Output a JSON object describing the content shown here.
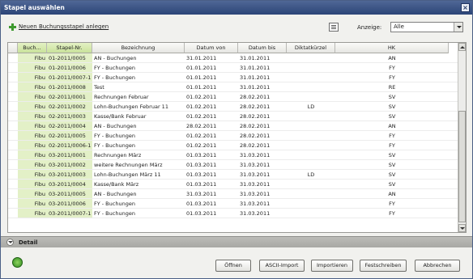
{
  "window": {
    "title": "Stapel auswählen",
    "close_glyph": "×"
  },
  "toolbar": {
    "new_label": "Neuen Buchungsstapel anlegen",
    "anzeige_label": "Anzeige:",
    "anzeige_value": "Alle"
  },
  "table": {
    "columns": [
      "",
      "Buch...",
      "Stapel-Nr.",
      "Bezeichnung",
      "Datum von",
      "Datum bis",
      "Diktatkürzel",
      "HK"
    ],
    "rows": [
      [
        "Fibu",
        "01-2011/0005",
        "AN - Buchungen",
        "31.01.2011",
        "31.01.2011",
        "",
        "AN"
      ],
      [
        "Fibu",
        "01-2011/0006",
        "FY - Buchungen",
        "01.01.2011",
        "31.01.2011",
        "",
        "FY"
      ],
      [
        "Fibu",
        "01-2011/0007-1",
        "FY - Buchungen",
        "01.01.2011",
        "31.01.2011",
        "",
        "FY"
      ],
      [
        "Fibu",
        "01-2011/0008",
        "Test",
        "01.01.2011",
        "31.01.2011",
        "",
        "RE"
      ],
      [
        "Fibu",
        "02-2011/0001",
        "Rechnungen Februar",
        "01.02.2011",
        "28.02.2011",
        "",
        "SV"
      ],
      [
        "Fibu",
        "02-2011/0002",
        "Lohn-Buchungen Februar 11",
        "01.02.2011",
        "28.02.2011",
        "LD",
        "SV"
      ],
      [
        "Fibu",
        "02-2011/0003",
        "Kasse/Bank Februar",
        "01.02.2011",
        "28.02.2011",
        "",
        "SV"
      ],
      [
        "Fibu",
        "02-2011/0004",
        "AN - Buchungen",
        "28.02.2011",
        "28.02.2011",
        "",
        "AN"
      ],
      [
        "Fibu",
        "02-2011/0005",
        "FY - Buchungen",
        "01.02.2011",
        "28.02.2011",
        "",
        "FY"
      ],
      [
        "Fibu",
        "02-2011/0006-1",
        "FY - Buchungen",
        "01.02.2011",
        "28.02.2011",
        "",
        "FY"
      ],
      [
        "Fibu",
        "03-2011/0001",
        "Rechnungen März",
        "01.03.2011",
        "31.03.2011",
        "",
        "SV"
      ],
      [
        "Fibu",
        "03-2011/0002",
        "weitere Rechnungen März",
        "01.03.2011",
        "31.03.2011",
        "",
        "SV"
      ],
      [
        "Fibu",
        "03-2011/0003",
        "Lohn-Buchungen März 11",
        "01.03.2011",
        "31.03.2011",
        "LD",
        "SV"
      ],
      [
        "Fibu",
        "03-2011/0004",
        "Kasse/Bank März",
        "01.03.2011",
        "31.03.2011",
        "",
        "SV"
      ],
      [
        "Fibu",
        "03-2011/0005",
        "AN - Buchungen",
        "31.03.2011",
        "31.03.2011",
        "",
        "AN"
      ],
      [
        "Fibu",
        "03-2011/0006",
        "FY - Buchungen",
        "01.03.2011",
        "31.03.2011",
        "",
        "FY"
      ],
      [
        "Fibu",
        "03-2011/0007-1",
        "FY - Buchungen",
        "01.03.2011",
        "31.03.2011",
        "",
        "FY"
      ]
    ]
  },
  "detail": {
    "label": "Detail"
  },
  "buttons": {
    "open": "Öffnen",
    "ascii": "ASCII-Import",
    "import": "Importieren",
    "commit": "Festschreiben",
    "cancel": "Abbrechen"
  },
  "colors": {
    "title_bar": "#2c4577",
    "highlight_column": "#e3f0c7",
    "status_green": "#3e9a2f"
  }
}
